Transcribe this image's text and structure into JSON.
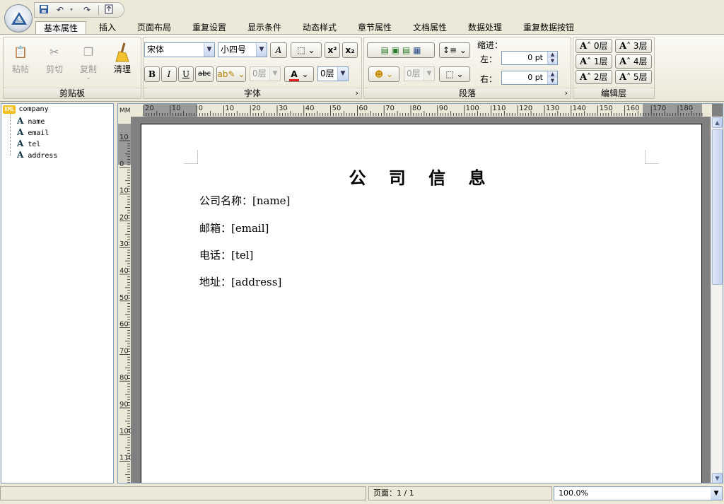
{
  "quick_access": {
    "icons": [
      "save-icon",
      "undo-icon",
      "redo-icon",
      "export-icon"
    ]
  },
  "tabs": [
    "基本属性",
    "插入",
    "页面布局",
    "重复设置",
    "显示条件",
    "动态样式",
    "章节属性",
    "文档属性",
    "数据处理",
    "重复数据按钮"
  ],
  "active_tab": "基本属性",
  "clipboard": {
    "label": "剪贴板",
    "paste": "粘帖",
    "cut": "剪切",
    "copy": "复制",
    "clear": "清理"
  },
  "font": {
    "label": "字体",
    "family": "宋体",
    "size": "小四号",
    "layer1": "0层",
    "layer2": "0层",
    "bold": "B",
    "italic": "I",
    "underline": "U",
    "strike": "abc"
  },
  "paragraph": {
    "label": "段落",
    "layer": "0层",
    "indent_label": "缩进：",
    "left_label": "左：",
    "right_label": "右：",
    "left_value": "0 pt",
    "right_value": "0 pt"
  },
  "edit_layer": {
    "label": "编辑层",
    "buttons": [
      "0层",
      "3层",
      "1层",
      "4层",
      "2层",
      "5层"
    ]
  },
  "tree": {
    "root": "company",
    "children": [
      "name",
      "email",
      "tel",
      "address"
    ]
  },
  "ruler": {
    "unit": "MM",
    "h_ticks": [
      "20",
      "10",
      "0",
      "10",
      "20",
      "30",
      "40",
      "50",
      "60",
      "70",
      "80",
      "90",
      "100",
      "110",
      "120",
      "130",
      "140",
      "150",
      "160",
      "170",
      "180"
    ],
    "v_ticks": [
      "10",
      "0",
      "10",
      "20",
      "30",
      "40",
      "50",
      "60",
      "70",
      "80",
      "90",
      "100",
      "110"
    ]
  },
  "document": {
    "title": "公 司 信 息",
    "lines": [
      "公司名称：[name]",
      "邮箱：[email]",
      "电话：[tel]",
      "地址：[address]"
    ]
  },
  "status": {
    "page": "页面：1 / 1",
    "zoom": "100.0%"
  },
  "colors": {
    "accent": "#316ac5",
    "font_color": "#e02020"
  }
}
